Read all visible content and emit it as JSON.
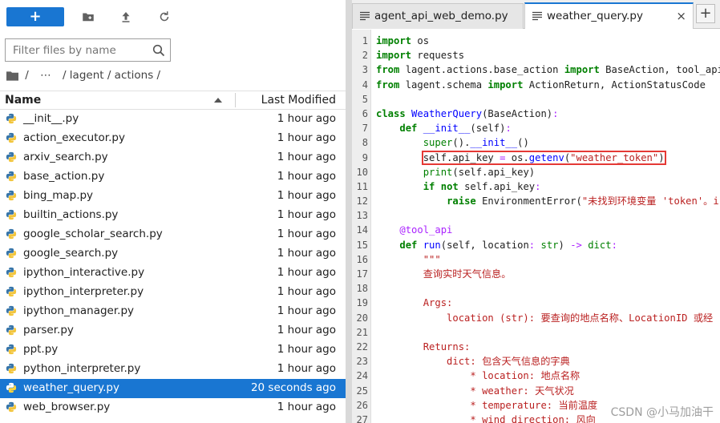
{
  "toolbar": {
    "new_label": "+",
    "icons": [
      "new-folder-icon",
      "upload-icon",
      "refresh-icon"
    ]
  },
  "search": {
    "placeholder": "Filter files by name",
    "value": ""
  },
  "breadcrumb": {
    "root_sep": "/",
    "ellipsis": "⋯",
    "path": "/ lagent / actions /"
  },
  "file_list": {
    "col_name": "Name",
    "col_modified": "Last Modified",
    "files": [
      {
        "name": "__init__.py",
        "modified": "1 hour ago"
      },
      {
        "name": "action_executor.py",
        "modified": "1 hour ago"
      },
      {
        "name": "arxiv_search.py",
        "modified": "1 hour ago"
      },
      {
        "name": "base_action.py",
        "modified": "1 hour ago"
      },
      {
        "name": "bing_map.py",
        "modified": "1 hour ago"
      },
      {
        "name": "builtin_actions.py",
        "modified": "1 hour ago"
      },
      {
        "name": "google_scholar_search.py",
        "modified": "1 hour ago"
      },
      {
        "name": "google_search.py",
        "modified": "1 hour ago"
      },
      {
        "name": "ipython_interactive.py",
        "modified": "1 hour ago"
      },
      {
        "name": "ipython_interpreter.py",
        "modified": "1 hour ago"
      },
      {
        "name": "ipython_manager.py",
        "modified": "1 hour ago"
      },
      {
        "name": "parser.py",
        "modified": "1 hour ago"
      },
      {
        "name": "ppt.py",
        "modified": "1 hour ago"
      },
      {
        "name": "python_interpreter.py",
        "modified": "1 hour ago"
      },
      {
        "name": "weather_query.py",
        "modified": "20 seconds ago",
        "selected": true
      },
      {
        "name": "web_browser.py",
        "modified": "1 hour ago"
      }
    ]
  },
  "editor": {
    "tabs": [
      {
        "label": "agent_api_web_demo.py",
        "active": false
      },
      {
        "label": "weather_query.py",
        "active": true
      }
    ],
    "close_glyph": "×",
    "add_tab_glyph": "+",
    "code": [
      "import os",
      "import requests",
      "from lagent.actions.base_action import BaseAction, tool_api",
      "from lagent.schema import ActionReturn, ActionStatusCode",
      "",
      "class WeatherQuery(BaseAction):",
      "    def __init__(self):",
      "        super().__init__()",
      "        self.api_key = os.getenv(\"weather_token\")",
      "        print(self.api_key)",
      "        if not self.api_key:",
      "            raise EnvironmentError(\"未找到环境变量 'token'。i",
      "",
      "    @tool_api",
      "    def run(self, location: str) -> dict:",
      "        \"\"\"",
      "        查询实时天气信息。",
      "",
      "        Args:",
      "            location (str): 要查询的地点名称、LocationID 或经",
      "",
      "        Returns:",
      "            dict: 包含天气信息的字典",
      "                * location: 地点名称",
      "                * weather: 天气状况",
      "                * temperature: 当前温度",
      "                * wind_direction: 风向"
    ],
    "highlighted_line": 9
  },
  "watermark": "CSDN @小马加油干"
}
